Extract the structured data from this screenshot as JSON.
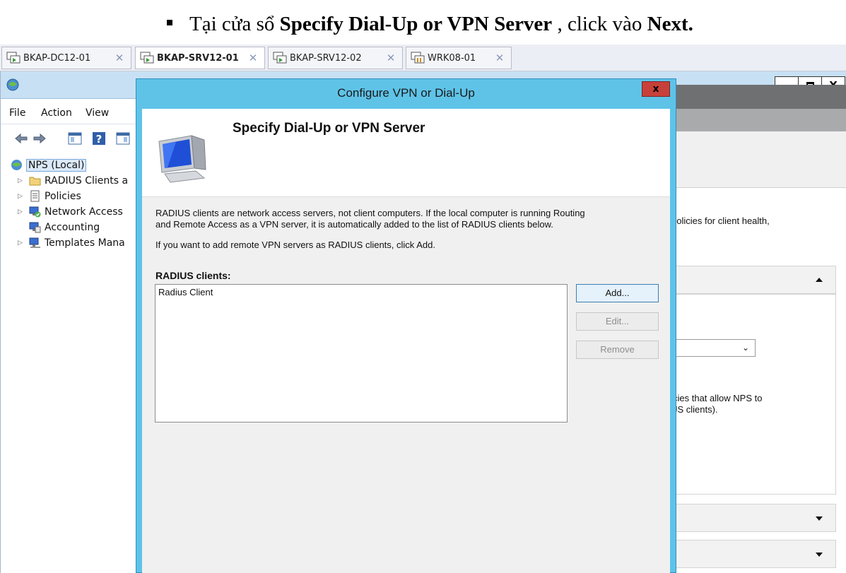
{
  "instruction": {
    "prefix": "Tại cửa sổ ",
    "dialog_name": "Specify Dial-Up or VPN Server",
    "middle": " , click vào ",
    "action": "Next."
  },
  "tabs": [
    {
      "label": "BKAP-DC12-01",
      "active": false
    },
    {
      "label": "BKAP-SRV12-01",
      "active": true
    },
    {
      "label": "BKAP-SRV12-02",
      "active": false
    },
    {
      "label": "WRK08-01",
      "active": false
    }
  ],
  "mmc": {
    "menu": [
      "File",
      "Action",
      "View"
    ],
    "tree": [
      {
        "label": "NPS (Local)",
        "icon": "nps-icon"
      },
      {
        "label": "RADIUS Clients a",
        "icon": "folder-icon"
      },
      {
        "label": "Policies",
        "icon": "policies-icon"
      },
      {
        "label": "Network Access",
        "icon": "network-access-icon"
      },
      {
        "label": "Accounting",
        "icon": "accounting-icon"
      },
      {
        "label": "Templates Mana",
        "icon": "templates-icon"
      }
    ],
    "right_pane": {
      "text1": "policies for client health,",
      "text2": "cies that allow NPS to",
      "text3": "JS clients)."
    }
  },
  "dialog": {
    "title": "Configure VPN or Dial-Up",
    "header_title": "Specify Dial-Up or VPN Server",
    "desc_line1": "RADIUS clients are network access servers, not client computers. If the local computer is running Routing",
    "desc_line2": "and Remote Access as a VPN server, it is automatically added to the list of RADIUS clients below.",
    "desc_line3": "If you want to add remote VPN servers as RADIUS clients, click Add.",
    "list_label": "RADIUS clients:",
    "list_items": [
      "Radius Client"
    ],
    "buttons": {
      "add": "Add...",
      "edit": "Edit...",
      "remove": "Remove"
    }
  },
  "colors": {
    "dialog_frame": "#5fc3e8",
    "close_button": "#c7413a",
    "mmc_titlebar": "#c7e0f4"
  }
}
